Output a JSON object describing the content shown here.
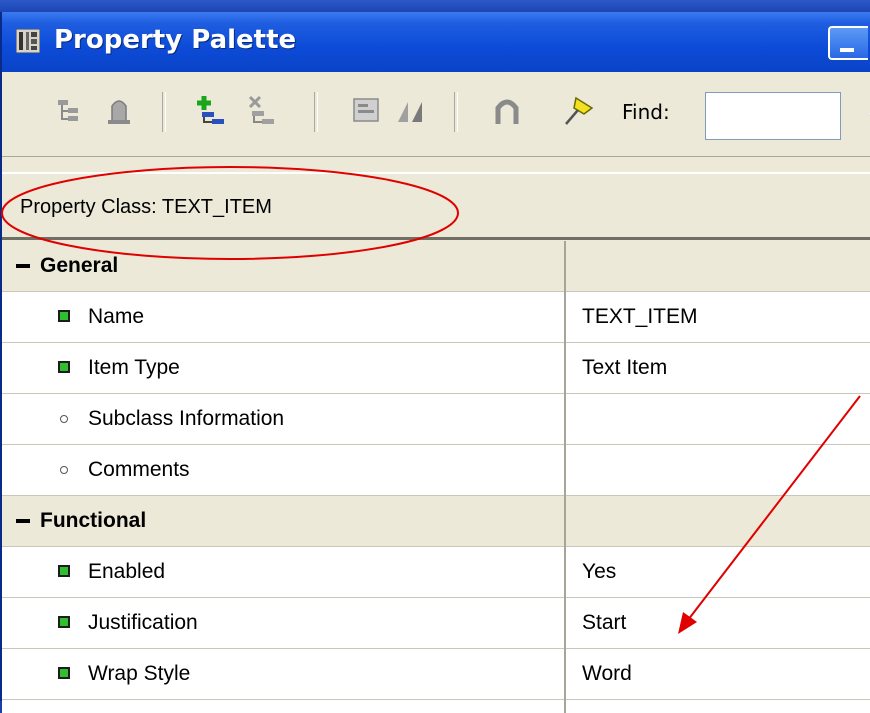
{
  "window": {
    "title": "Property Palette"
  },
  "toolbar": {
    "find_label": "Find:",
    "find_value": ""
  },
  "property_class": {
    "label": "Property Class: TEXT_ITEM"
  },
  "grid": {
    "rows": [
      {
        "type": "category",
        "name": "General",
        "value": ""
      },
      {
        "type": "property",
        "name": "Name",
        "value": "TEXT_ITEM",
        "marker": "set"
      },
      {
        "type": "property",
        "name": "Item Type",
        "value": "Text Item",
        "marker": "set"
      },
      {
        "type": "property",
        "name": "Subclass Information",
        "value": "",
        "marker": "default"
      },
      {
        "type": "property",
        "name": "Comments",
        "value": "",
        "marker": "default"
      },
      {
        "type": "category",
        "name": "Functional",
        "value": ""
      },
      {
        "type": "property",
        "name": "Enabled",
        "value": "Yes",
        "marker": "set"
      },
      {
        "type": "property",
        "name": "Justification",
        "value": "Start",
        "marker": "set"
      },
      {
        "type": "property",
        "name": "Wrap Style",
        "value": "Word",
        "marker": "set"
      }
    ]
  },
  "colors": {
    "titlebar": "#0c4bd8",
    "window_bg": "#ece9d8",
    "annotation": "#e00000"
  },
  "icons": {
    "title": "property-palette-icon",
    "toolbar": [
      "expand-tree-icon",
      "bell-icon",
      "create-icon",
      "delete-icon",
      "copy-properties-icon",
      "paste-properties-icon",
      "intersection-icon",
      "pin-icon"
    ]
  }
}
